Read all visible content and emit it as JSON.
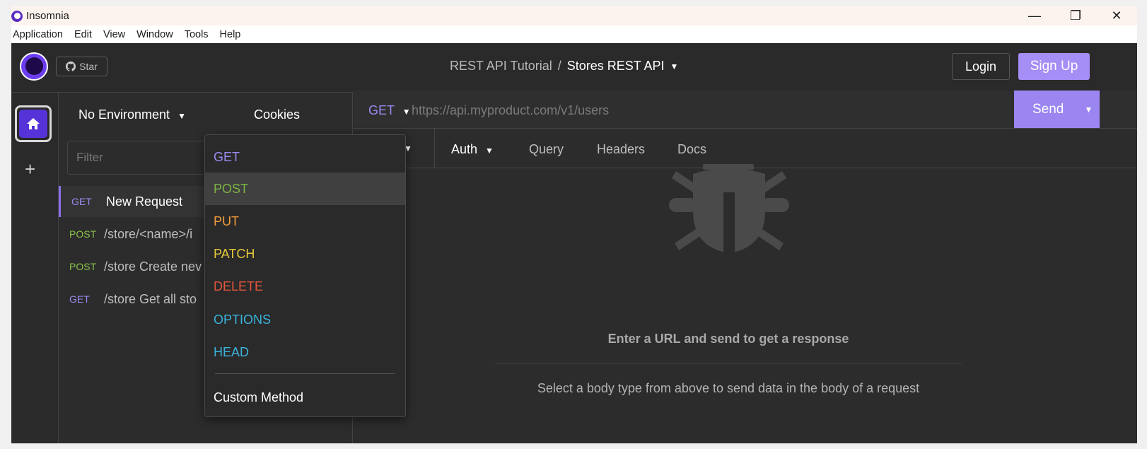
{
  "window": {
    "title": "Insomnia",
    "minimize": "—",
    "restore": "❐",
    "close": "✕"
  },
  "menubar": [
    "Application",
    "Edit",
    "View",
    "Window",
    "Tools",
    "Help"
  ],
  "header": {
    "star_label": "Star",
    "breadcrumb_project": "REST API Tutorial",
    "breadcrumb_sep": "/",
    "breadcrumb_current": "Stores REST API",
    "login_label": "Login",
    "signup_label": "Sign Up"
  },
  "sidebar": {
    "environment": "No Environment",
    "cookies": "Cookies",
    "filter_placeholder": "Filter",
    "requests": [
      {
        "method": "GET",
        "name": "New Request",
        "active": true
      },
      {
        "method": "POST",
        "name": "/store/<name>/i"
      },
      {
        "method": "POST",
        "name": "/store Create nev"
      },
      {
        "method": "GET",
        "name": "/store Get all sto"
      }
    ]
  },
  "urlbar": {
    "method": "GET",
    "placeholder": "https://api.myproduct.com/v1/users",
    "send_label": "Send"
  },
  "tabs": {
    "auth": "Auth",
    "query": "Query",
    "headers": "Headers",
    "docs": "Docs"
  },
  "response": {
    "title": "Enter a URL and send to get a response",
    "subtitle": "Select a body type from above to send data in the body of a request"
  },
  "method_dropdown": {
    "items": [
      "GET",
      "POST",
      "PUT",
      "PATCH",
      "DELETE",
      "OPTIONS",
      "HEAD"
    ],
    "hovered": "POST",
    "custom": "Custom Method"
  },
  "colors": {
    "accent": "#9b85f0",
    "get": "#9c88ee",
    "post": "#7cb342",
    "put": "#f29a3a",
    "patch": "#e6c83a",
    "delete": "#e4573b",
    "options": "#3bb4dc",
    "head": "#3bb4dc"
  }
}
